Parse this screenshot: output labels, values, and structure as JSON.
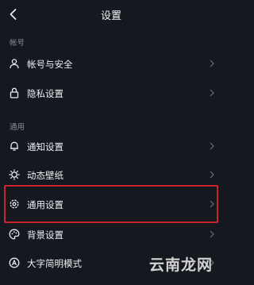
{
  "header": {
    "title": "设置",
    "back_icon": "chevron-left-icon"
  },
  "sections": [
    {
      "title": "帐号"
    },
    {
      "title": "通用"
    }
  ],
  "items": [
    {
      "label": "帐号与安全",
      "icon": "user-icon"
    },
    {
      "label": "隐私设置",
      "icon": "lock-icon"
    },
    {
      "label": "通知设置",
      "icon": "bell-icon"
    },
    {
      "label": "动态壁纸",
      "icon": "wallpaper-icon"
    },
    {
      "label": "通用设置",
      "icon": "gear-icon"
    },
    {
      "label": "背景设置",
      "icon": "palette-icon"
    },
    {
      "label": "大字简明模式",
      "icon": "font-size-icon"
    }
  ],
  "watermark": "云南龙网",
  "colors": {
    "background": "#16181f",
    "highlight": "#c8252f"
  }
}
